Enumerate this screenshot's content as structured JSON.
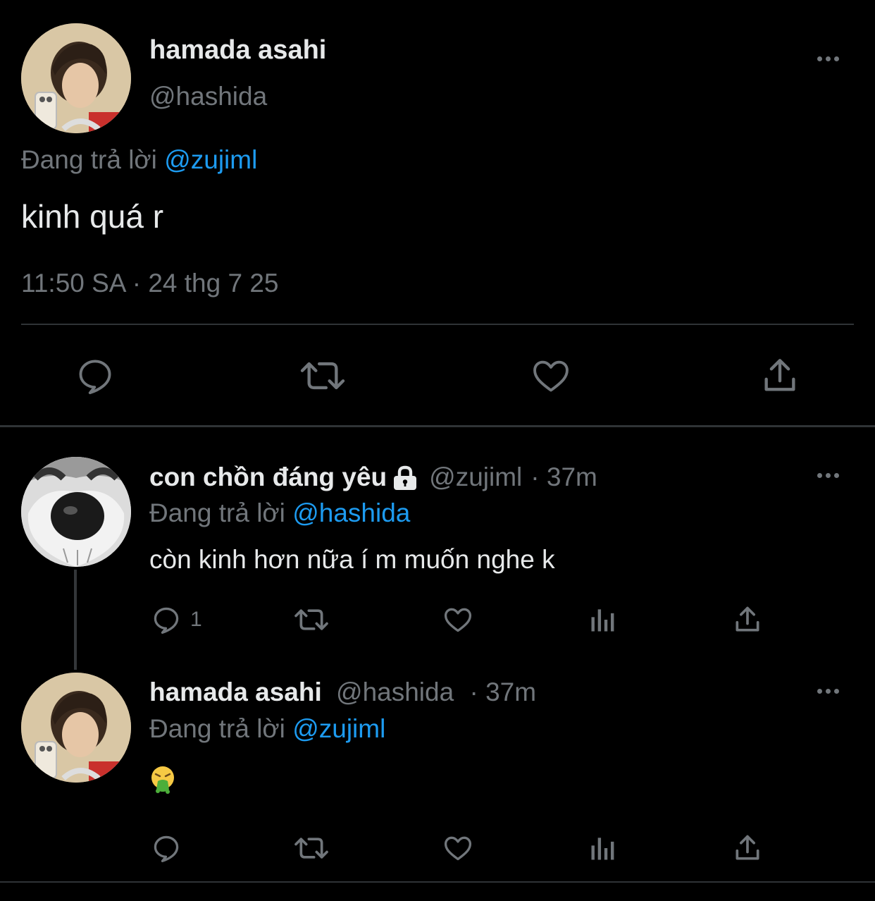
{
  "main_tweet": {
    "display_name": "hamada asahi",
    "handle": "@hashida",
    "replying_prefix": "Đang trả lời",
    "replying_to": "@zujiml",
    "text": "kinh quá r",
    "timestamp": "11:50 SA · 24 thg 7 25",
    "avatar_icon": "person-selfie-avatar",
    "actions": [
      "reply-icon",
      "retweet-icon",
      "like-icon",
      "share-icon"
    ]
  },
  "replies": [
    {
      "display_name": "con chồn đáng yêu",
      "locked": true,
      "handle": "@zujiml",
      "time": "· 37m",
      "replying_prefix": "Đang trả lời",
      "replying_to": "@hashida",
      "text": "còn kinh hơn nữa í m muốn nghe k",
      "reply_count": "1",
      "avatar_icon": "raccoon-nose-avatar"
    },
    {
      "display_name": "hamada asahi",
      "handle": "@hashida",
      "time": "· 37m",
      "replying_prefix": "Đang trả lời",
      "replying_to": "@zujiml",
      "text": "🤮",
      "reply_count": "",
      "avatar_icon": "person-selfie-avatar"
    }
  ],
  "colors": {
    "background": "#000000",
    "text": "#e7e9ea",
    "secondary": "#71767b",
    "link": "#1d9bf0",
    "divider": "#2f3336"
  }
}
